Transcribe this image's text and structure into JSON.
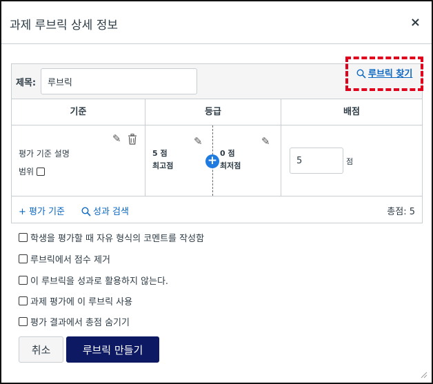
{
  "dialog": {
    "title": "과제 루브릭 상세 정보",
    "close": "×"
  },
  "rubric": {
    "title_label": "제목:",
    "title_value": "루브릭",
    "find_rubric": "루브릭 찾기",
    "columns": {
      "criteria": "기준",
      "ratings": "등급",
      "points": "배점"
    },
    "criterion": {
      "description": "평가 기준 설명",
      "range_label": "범위",
      "ratings": [
        {
          "points": "5 점",
          "label": "최고점"
        },
        {
          "points": "0 점",
          "label": "최저점"
        }
      ],
      "points_value": "5",
      "points_unit": "점"
    },
    "add_criterion": "+ 평가 기준",
    "search_outcome": "성과 검색",
    "total": "총점: 5"
  },
  "options": [
    "학생을 평가할 때 자유 형식의 코멘트를 작성함",
    "루브릭에서 점수 제거",
    "이 루브릭을 성과로 활용하지 않는다.",
    "과제 평가에 이 루브릭 사용",
    "평가 결과에서 총점 숨기기"
  ],
  "buttons": {
    "cancel": "취소",
    "create": "루브릭 만들기"
  },
  "colors": {
    "accent_link": "#0b67c2",
    "primary_button": "#0d1a63",
    "highlight_box": "#e0001b",
    "add_rating": "#1f7be0"
  }
}
